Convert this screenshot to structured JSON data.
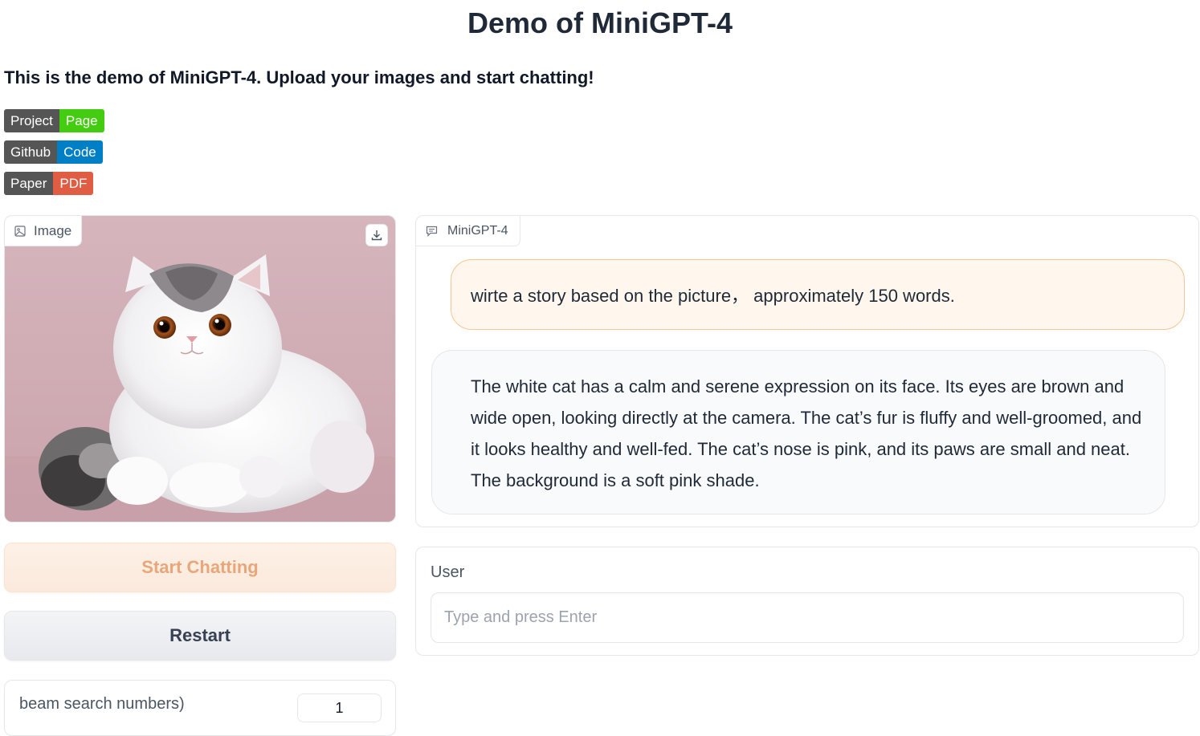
{
  "header": {
    "title": "Demo of MiniGPT-4",
    "subtitle": "This is the demo of MiniGPT-4. Upload your images and start chatting!"
  },
  "badges": [
    {
      "left": "Project",
      "right": "Page",
      "right_color": "#44cc11"
    },
    {
      "left": "Github",
      "right": "Code",
      "right_color": "#007ec6"
    },
    {
      "left": "Paper",
      "right": "PDF",
      "right_color": "#e05d44"
    }
  ],
  "image_panel": {
    "label": "Image",
    "label_icon": "image-icon",
    "download_icon": "download-icon"
  },
  "buttons": {
    "start": "Start Chatting",
    "restart": "Restart"
  },
  "beam": {
    "label": "beam search numbers)",
    "value": "1"
  },
  "chat": {
    "label": "MiniGPT-4",
    "label_icon": "chat-icon",
    "user_message": "wirte a story based on the picture， approximately 150 words.",
    "bot_message": "The white cat has a calm and serene expression on its face. Its eyes are brown and wide open, looking directly at the camera. The cat’s fur is fluffy and well-groomed, and it looks healthy and well-fed. The cat’s nose is pink, and its paws are small and neat. The background is a soft pink shade."
  },
  "user_input": {
    "label": "User",
    "placeholder": "Type and press Enter",
    "value": ""
  },
  "colors": {
    "accent_user_bubble": "#fff7ee",
    "accent_user_border": "#f7c58f",
    "start_button_text": "#e8a77b"
  }
}
